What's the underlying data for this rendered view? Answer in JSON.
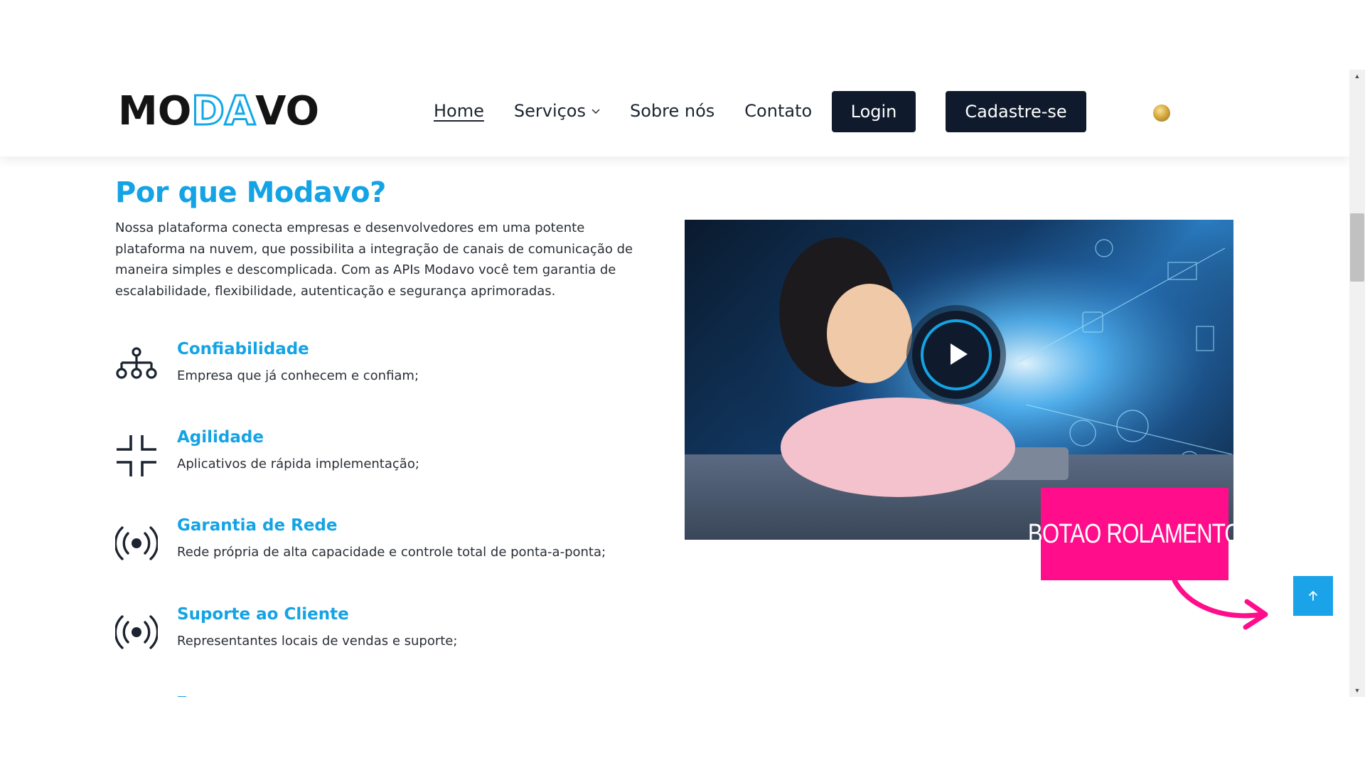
{
  "brand": {
    "logo_parts": [
      "MO",
      "DA",
      "VO"
    ]
  },
  "nav": {
    "links": [
      "Home",
      "Serviços",
      "Sobre nós",
      "Contato"
    ],
    "login": "Login",
    "signup": "Cadastre-se",
    "flag_icon": "language-flag-icon"
  },
  "main": {
    "title": "Por que Modavo?",
    "intro": "Nossa plataforma conecta empresas e desenvolvedores em uma potente plataforma na nuvem, que possibilita a integração de canais de comunicação de maneira simples e descomplicada. Com as APIs Modavo você tem garantia de escalabilidade, flexibilidade, autenticação e segurança aprimoradas.",
    "features": [
      {
        "icon": "network-icon",
        "title": "Confiabilidade",
        "desc": "Empresa que já conhecem e confiam;"
      },
      {
        "icon": "collapse-icon",
        "title": "Agilidade",
        "desc": "Aplicativos de rápida implementação;"
      },
      {
        "icon": "broadcast-icon",
        "title": "Garantia de Rede",
        "desc": "Rede própria de alta capacidade e controle total de ponta-a-ponta;"
      },
      {
        "icon": "broadcast-icon",
        "title": "Suporte ao Cliente",
        "desc": "Representantes locais de vendas e suporte;"
      }
    ]
  },
  "video": {
    "play_icon": "play-icon"
  },
  "annotation": {
    "label": "BOTAO ROLAMENTO"
  },
  "scroll_top": {
    "icon": "arrow-up-icon"
  },
  "colors": {
    "accent": "#14a3e4",
    "dark": "#0f1b2d",
    "annotation": "#ff0d8a"
  }
}
